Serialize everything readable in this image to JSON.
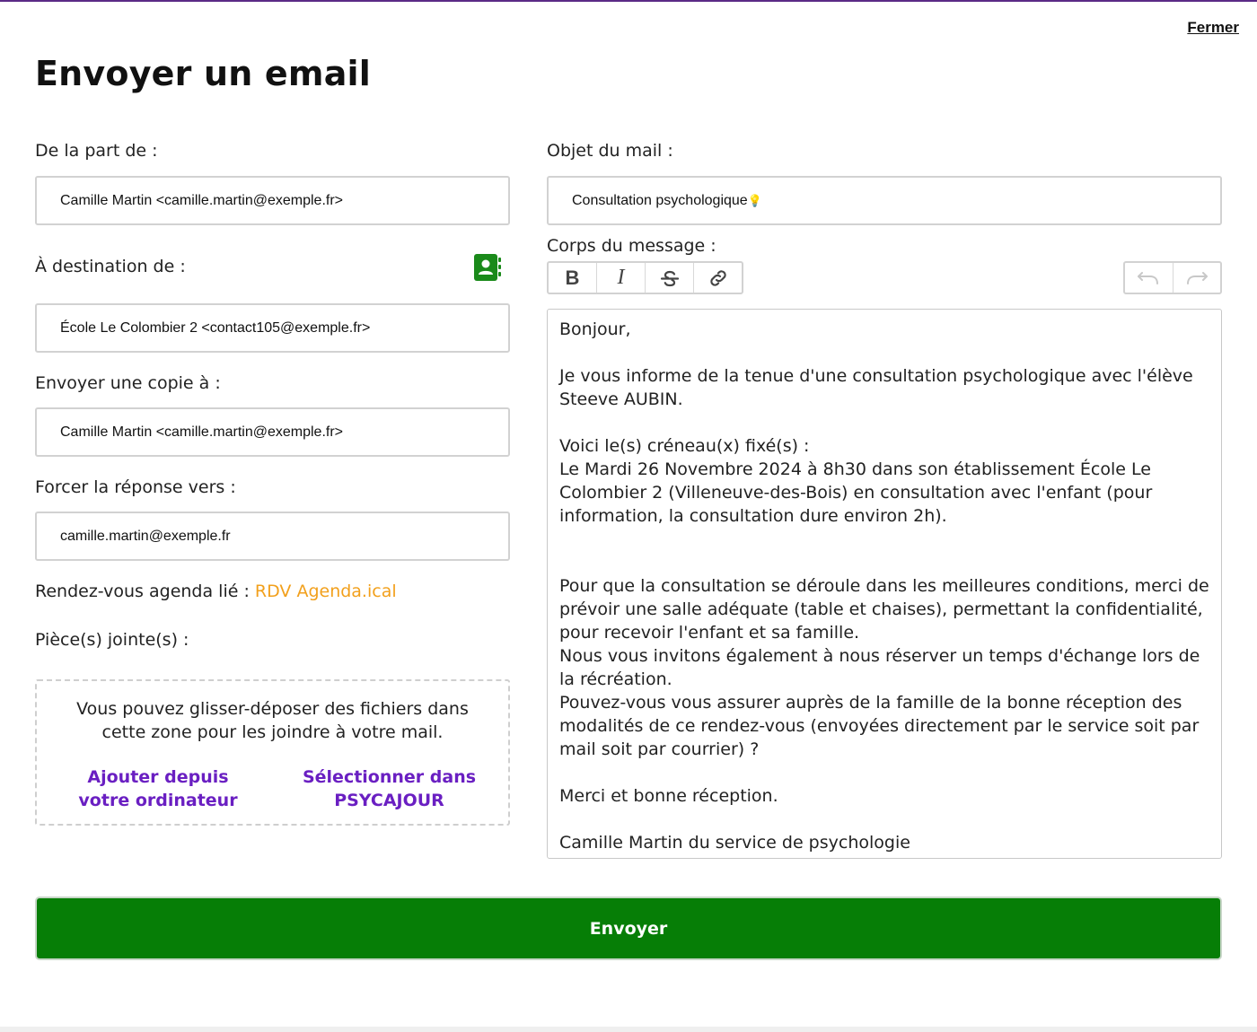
{
  "modal": {
    "close_label": "Fermer",
    "title": "Envoyer un email"
  },
  "from": {
    "label": "De la part de :",
    "value": "Camille Martin <camille.martin@exemple.fr>"
  },
  "to": {
    "label": "À destination de :",
    "value": "École Le Colombier 2 <contact105@exemple.fr>",
    "contacts_icon": "address-book-icon"
  },
  "cc": {
    "label": "Envoyer une copie à :",
    "value": "Camille Martin <camille.martin@exemple.fr>"
  },
  "reply_to": {
    "label": "Forcer la réponse vers :",
    "value": "camille.martin@exemple.fr"
  },
  "agenda": {
    "label": "Rendez-vous agenda lié : ",
    "link": "RDV Agenda.ical"
  },
  "attachments": {
    "label": "Pièce(s) jointe(s) :",
    "dropzone_text": "Vous pouvez glisser-déposer des fichiers dans cette zone pour les joindre à votre mail.",
    "add_from_computer": "Ajouter depuis votre ordinateur",
    "select_from_app": "Sélectionner dans PSYCAJOUR"
  },
  "subject": {
    "label": "Objet du mail :",
    "value": "Consultation psychologique",
    "emoji": "💡"
  },
  "body": {
    "label": "Corps du message :",
    "toolbar": {
      "bold": "B",
      "italic": "I",
      "strike_icon": "strikethrough-icon",
      "link_icon": "link-icon",
      "undo_icon": "undo-icon",
      "redo_icon": "redo-icon"
    },
    "lines": [
      "Bonjour,",
      "",
      "Je vous informe de la tenue d'une consultation psychologique avec l'élève Steeve AUBIN.",
      "",
      "Voici le(s) créneau(x) fixé(s) :",
      "Le Mardi 26 Novembre 2024 à 8h30 dans son établissement École Le Colombier 2 (Villeneuve-des-Bois) en consultation avec l'enfant (pour information, la consultation dure environ 2h).",
      "",
      "",
      "Pour que la consultation se déroule dans les meilleures conditions, merci de prévoir une salle adéquate (table et chaises), permettant la confidentialité, pour recevoir l'enfant et sa famille.",
      "Nous vous invitons également à nous réserver un temps d'échange lors de la récréation.",
      "Pouvez-vous vous assurer auprès de la famille de la bonne réception des modalités de ce rendez-vous (envoyées directement par le service soit par mail soit par courrier) ?",
      "",
      "Merci et bonne réception.",
      "",
      "Camille Martin du service de psychologie"
    ]
  },
  "send_label": "Envoyer",
  "colors": {
    "send_button": "#067e06",
    "contacts_icon": "#1a8a1a",
    "agenda_link": "#f2a01c",
    "dropzone_links": "#6a1fc2",
    "top_border": "#5b2a86"
  }
}
